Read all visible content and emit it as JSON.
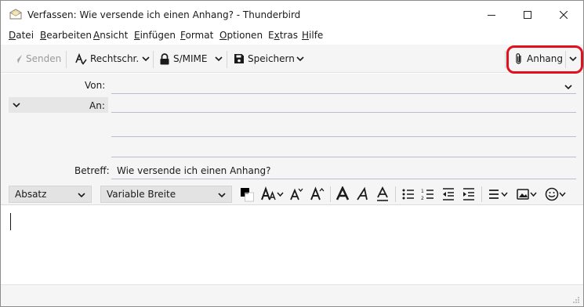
{
  "window": {
    "title": "Verfassen: Wie versende ich einen Anhang? - Thunderbird"
  },
  "menu": {
    "items": [
      {
        "label": "Datei",
        "key": "D"
      },
      {
        "label": "Bearbeiten",
        "key": "B"
      },
      {
        "label": "Ansicht",
        "key": "A"
      },
      {
        "label": "Einfügen",
        "key": "E"
      },
      {
        "label": "Format",
        "key": "F"
      },
      {
        "label": "Optionen",
        "key": "O"
      },
      {
        "label": "Extras",
        "key": "x"
      },
      {
        "label": "Hilfe",
        "key": "H"
      }
    ]
  },
  "toolbar": {
    "send_label": "Senden",
    "spelling_label": "Rechtschr.",
    "smime_label": "S/MIME",
    "save_label": "Speichern",
    "attach_label": "Anhang"
  },
  "headers": {
    "from_label": "Von:",
    "to_label": "An:",
    "subject_label": "Betreff:",
    "subject_value": "Wie versende ich einen Anhang?"
  },
  "format": {
    "paragraph_value": "Absatz",
    "font_value": "Variable Breite"
  },
  "colors": {
    "highlight": "#e0101c",
    "toolbar_bg": "#f5f5f5",
    "field_line": "#b9bdcf"
  }
}
